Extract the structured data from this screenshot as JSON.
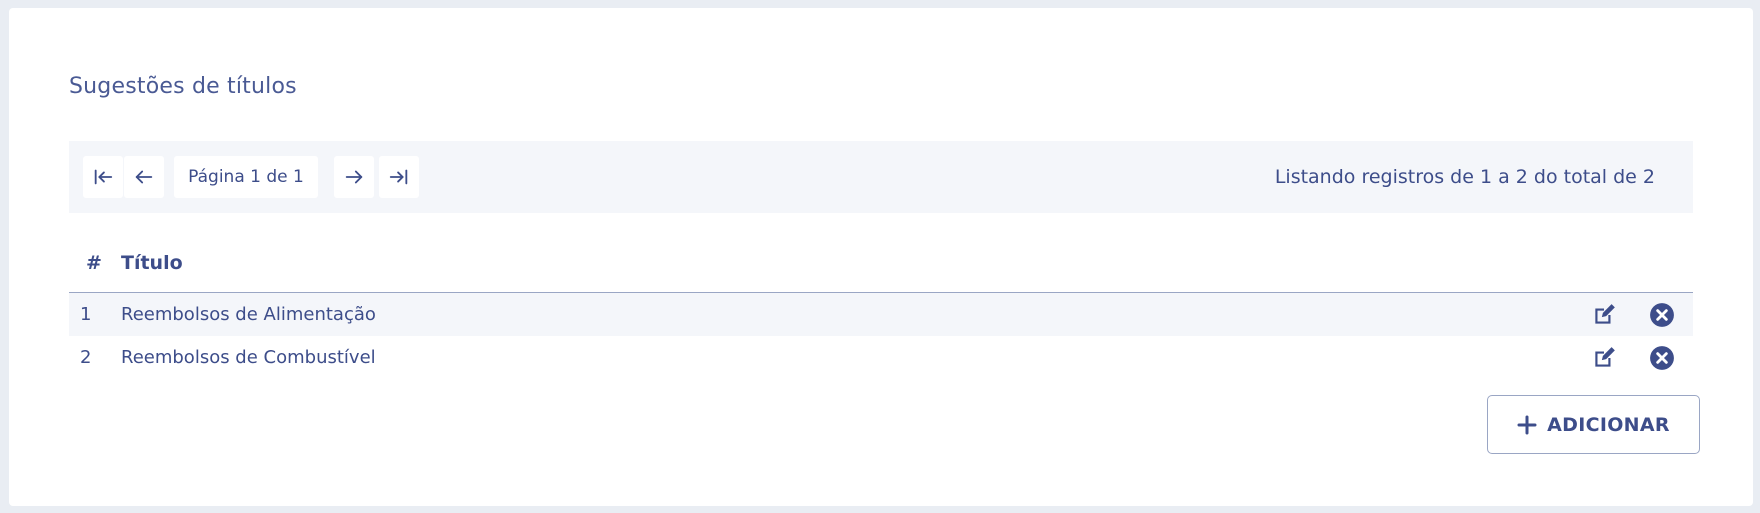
{
  "page": {
    "title": "Sugestões de títulos"
  },
  "pagination": {
    "first_icon": "first-page-icon",
    "prev_icon": "arrow-left-icon",
    "page_label": "Página 1 de 1",
    "next_icon": "arrow-right-icon",
    "last_icon": "last-page-icon",
    "records_text": "Listando registros de 1 a 2 do total de 2"
  },
  "table": {
    "columns": [
      "#",
      "Título"
    ],
    "rows": [
      {
        "num": "1",
        "title": "Reembolsos de Alimentação"
      },
      {
        "num": "2",
        "title": "Reembolsos de Combustível"
      }
    ],
    "actions": [
      "edit-icon",
      "delete-icon"
    ]
  },
  "footer": {
    "add_label": "ADICIONAR",
    "add_icon": "plus-icon"
  },
  "colors": {
    "accent": "#3d4d8a",
    "bar_background": "#f4f6fa",
    "page_background": "#e9edf3"
  }
}
